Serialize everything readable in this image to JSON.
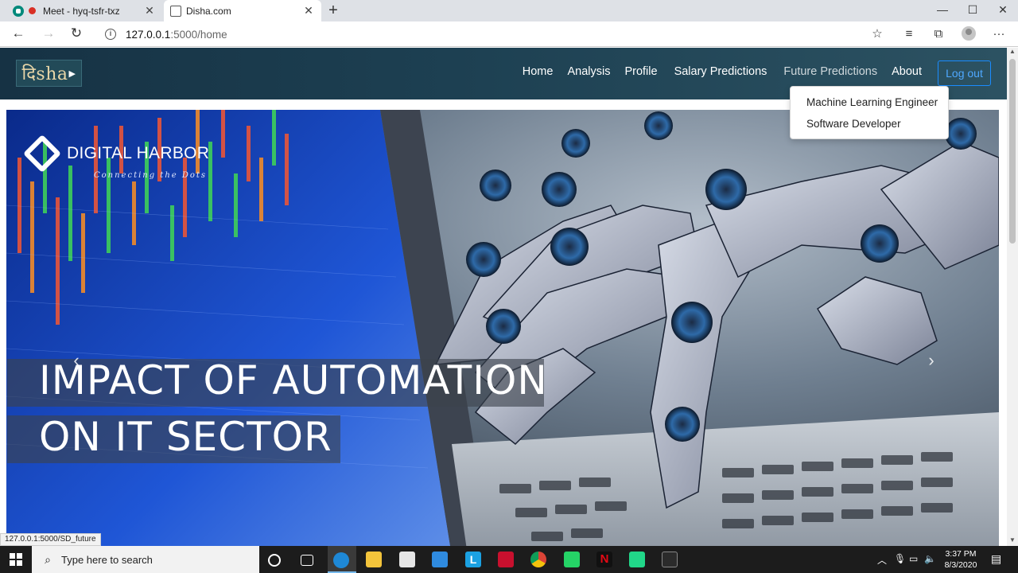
{
  "browser": {
    "tabs": [
      {
        "title": "Meet - hyq-tsfr-txz",
        "active": false
      },
      {
        "title": "Disha.com",
        "active": true
      }
    ],
    "new_tab": "+",
    "window_controls": {
      "minimize": "—",
      "maximize": "☐",
      "close": "✕"
    },
    "address": {
      "host": "127.0.0.1",
      "path": ":5000/home"
    },
    "status_url": "127.0.0.1:5000/SD_future"
  },
  "site": {
    "logo_text": "दिsha",
    "nav": {
      "home": "Home",
      "analysis": "Analysis",
      "profile": "Profile",
      "salary": "Salary Predictions",
      "future": "Future Predictions",
      "about": "About",
      "logout": "Log out"
    },
    "dropdown": [
      "Machine Learning Engineer",
      "Software Developer"
    ],
    "hero": {
      "brand_name": "DIGITAL HARBOR",
      "brand_tagline": "Connecting the Dots",
      "caption_line1": "IMPACT OF AUTOMATION",
      "caption_line2": "ON IT SECTOR"
    }
  },
  "taskbar": {
    "search_placeholder": "Type here to search",
    "time": "3:37 PM",
    "date": "8/3/2020",
    "apps": [
      "cortana",
      "task-view",
      "edge",
      "file-explorer",
      "store",
      "mail",
      "l-app",
      "mcafee",
      "chrome",
      "whatsapp",
      "netflix",
      "pycharm",
      "terminal"
    ]
  },
  "colors": {
    "nav_bg": "#1d4052",
    "logout_border": "#1a8cff",
    "accent_blue": "#4fa8ff"
  }
}
